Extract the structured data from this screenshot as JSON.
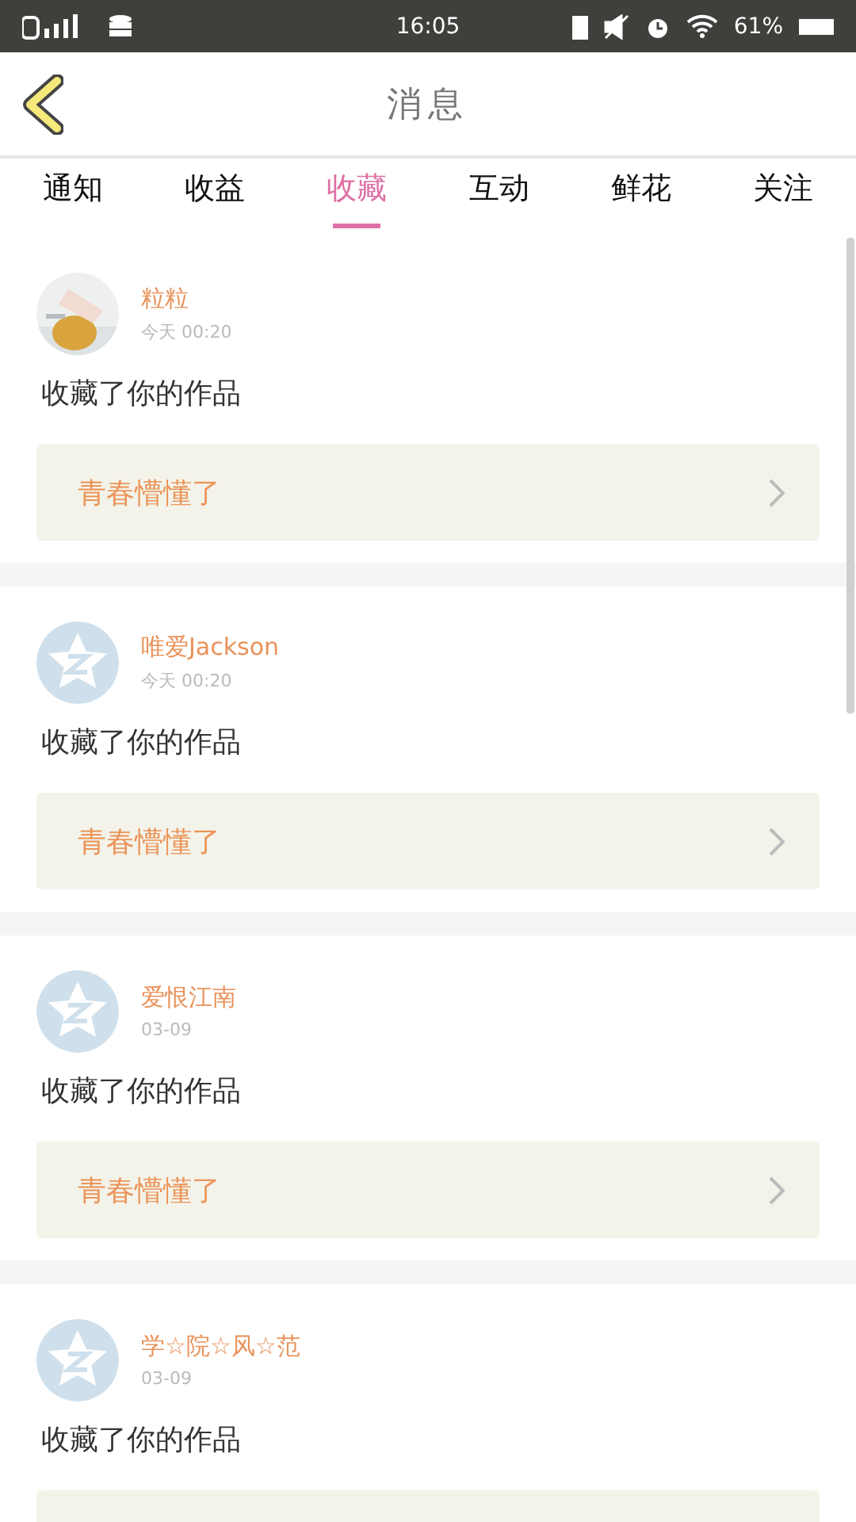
{
  "status_bar": {
    "time": "16:05",
    "battery": "61%"
  },
  "header": {
    "title": "消息"
  },
  "tabs": [
    {
      "label": "通知",
      "selected": false
    },
    {
      "label": "收益",
      "selected": false
    },
    {
      "label": "收藏",
      "selected": true
    },
    {
      "label": "互动",
      "selected": false
    },
    {
      "label": "鲜花",
      "selected": false
    },
    {
      "label": "关注",
      "selected": false
    }
  ],
  "messages": [
    {
      "kind": "picture",
      "name": "粒粒",
      "time": "今天 00:20",
      "text": "收藏了你的作品",
      "work_title": "青春懵懂了"
    },
    {
      "kind": "default",
      "name": "唯爱Jackson",
      "time": "今天 00:20",
      "text": "收藏了你的作品",
      "work_title": "青春懵懂了"
    },
    {
      "kind": "default",
      "name": "爱恨江南",
      "time": "03-09",
      "text": "收藏了你的作品",
      "work_title": "青春懵懂了"
    },
    {
      "kind": "default",
      "name": "学☆院☆风☆范",
      "time": "03-09",
      "text": "收藏了你的作品"
    }
  ]
}
